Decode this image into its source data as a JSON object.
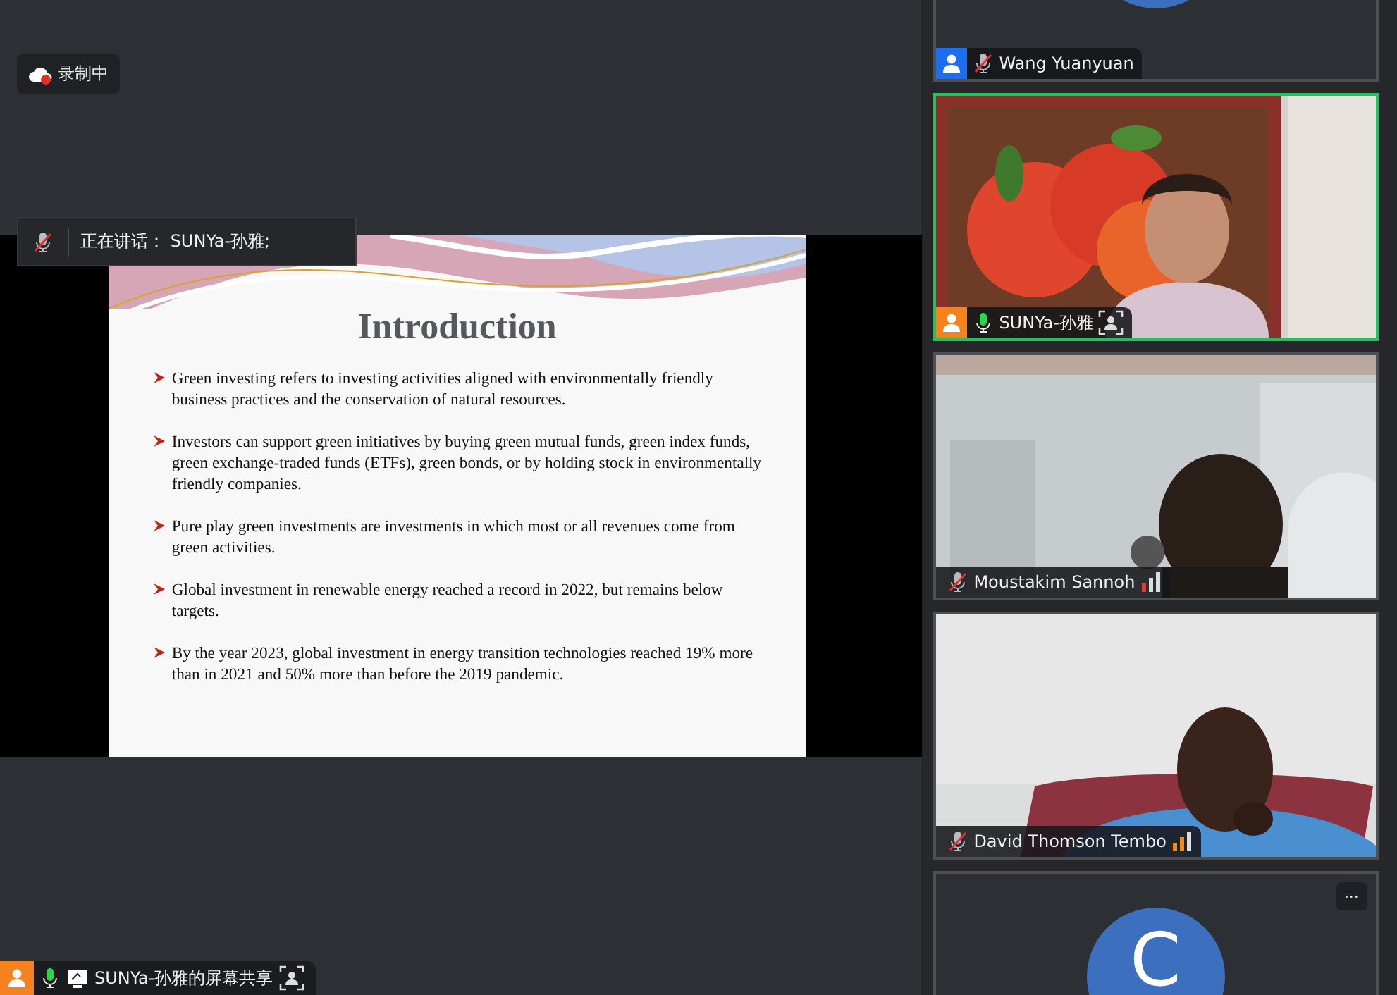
{
  "recording": {
    "label": "录制中"
  },
  "speaking_banner": {
    "text": "正在讲话：  SUNYa-孙雅;",
    "mic_muted": true
  },
  "slide": {
    "title": "Introduction",
    "bullets": [
      "Green investing refers to investing activities aligned with environmentally friendly business practices and the conservation of natural resources.",
      "Investors can support green initiatives by buying green mutual funds, green index funds, green exchange-traded funds (ETFs), green bonds, or by holding stock in environmentally friendly companies.",
      "Pure play green investments are investments in which most or all revenues come from green activities.",
      "Global investment in renewable energy reached a record in 2022, but remains below targets.",
      "By the year 2023, global investment in energy transition technologies reached 19% more than in 2021 and 50% more than before the 2019 pandemic."
    ]
  },
  "share_label": {
    "name": "SUNYa-孙雅的屏幕共享",
    "mic_muted": false,
    "color": "#f5821f",
    "spotlight": true
  },
  "participants": [
    {
      "name": "Wang Yuanyuan",
      "kind": "avatar",
      "muted": true,
      "active_speaker": false,
      "color": "#1a6ff0",
      "spotlight": false
    },
    {
      "name": "SUNYa-孙雅",
      "kind": "video",
      "muted": false,
      "active_speaker": true,
      "color": "#f5821f",
      "spotlight": true
    },
    {
      "name": "Moustakim Sannoh",
      "kind": "video",
      "muted": true,
      "active_speaker": false,
      "signal": {
        "color": "#e23a2e"
      },
      "spotlight": false
    },
    {
      "name": "David Thomson Tembo",
      "kind": "video",
      "muted": true,
      "active_speaker": false,
      "signal": {
        "color": "#f28b1c"
      },
      "spotlight": false
    },
    {
      "kind": "avatar",
      "initial": "C",
      "more": "···",
      "active_speaker": false
    }
  ]
}
